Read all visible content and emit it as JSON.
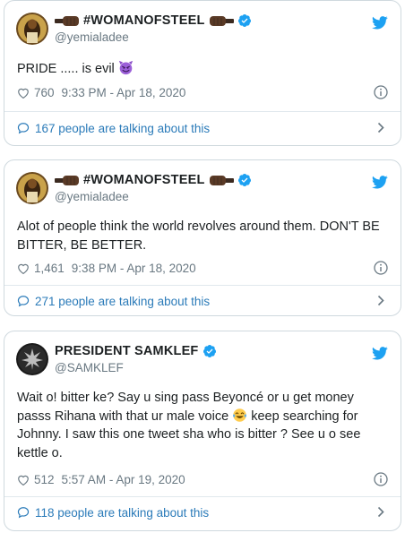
{
  "tweets": [
    {
      "display_name": "#WOMANOFSTEEL",
      "handle": "@yemialadee",
      "text": "PRIDE ..... is evil",
      "likes": "760",
      "timestamp": "9:33 PM - Apr 18, 2020",
      "talking": "167 people are talking about this"
    },
    {
      "display_name": "#WOMANOFSTEEL",
      "handle": "@yemialadee",
      "text": "Alot of people think the world revolves around them. DON'T BE BITTER, BE BETTER.",
      "likes": "1,461",
      "timestamp": "9:38 PM - Apr 18, 2020",
      "talking": "271 people are talking about this"
    },
    {
      "display_name": "PRESIDENT SAMKLEF",
      "handle": "@SAMKLEF",
      "text_a": "Wait o! bitter ke? Say u sing pass Beyoncé or u get money passs Rihana with that ur male voice",
      "text_b": "keep searching for Johnny. I saw this one tweet sha who is bitter ? See u o see kettle o.",
      "likes": "512",
      "timestamp": "5:57 AM - Apr 19, 2020",
      "talking": "118 people are talking about this"
    }
  ],
  "colors": {
    "link_blue": "#2b7bb9",
    "verified_blue": "#1da1f2",
    "muted_gray": "#697882",
    "text": "#1c2022",
    "border": "#cfd9de"
  },
  "icons": [
    "fist-emoji-icon",
    "verified-badge-icon",
    "twitter-bird-icon",
    "smiling-devil-emoji-icon",
    "heart-icon",
    "info-icon",
    "speech-bubble-icon",
    "chevron-right-icon",
    "tears-of-joy-emoji-icon"
  ]
}
